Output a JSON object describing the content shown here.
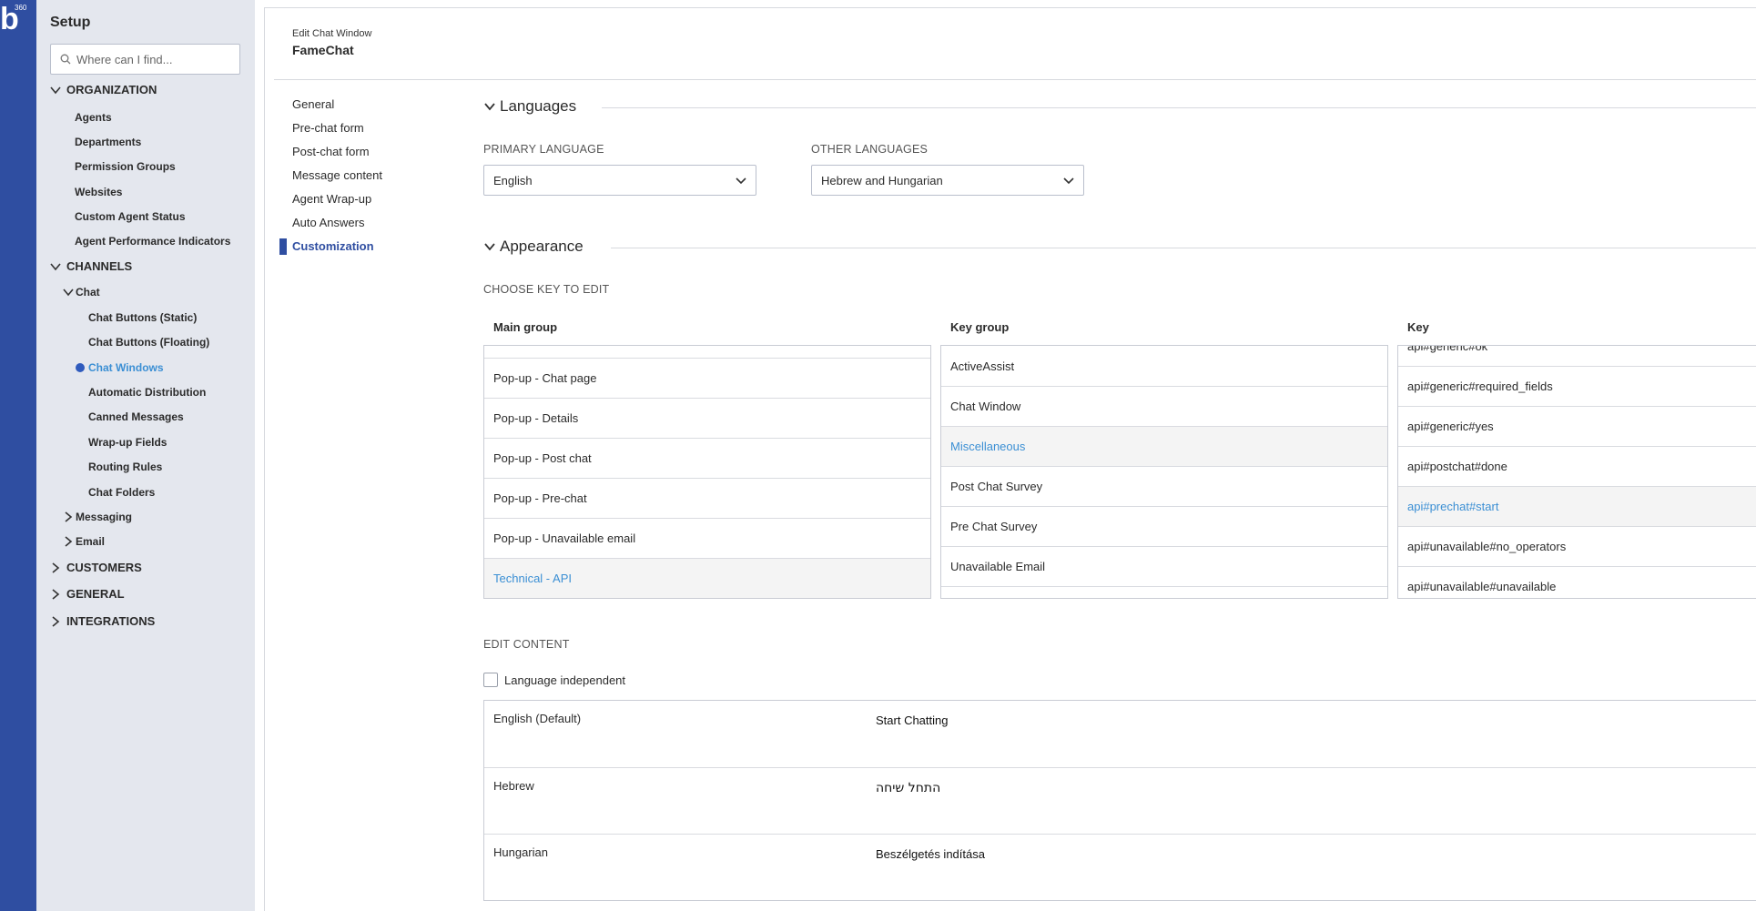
{
  "brand": {
    "letter": "b",
    "sup": "360"
  },
  "sidebar": {
    "title": "Setup",
    "search_placeholder": "Where can I find...",
    "sections": {
      "organization": "ORGANIZATION",
      "channels": "CHANNELS",
      "customers": "CUSTOMERS",
      "general": "GENERAL",
      "integrations": "INTEGRATIONS"
    },
    "org_items": [
      "Agents",
      "Departments",
      "Permission Groups",
      "Websites",
      "Custom Agent Status",
      "Agent Performance Indicators"
    ],
    "chat_label": "Chat",
    "chat_items": [
      "Chat Buttons (Static)",
      "Chat Buttons (Floating)",
      "Chat Windows",
      "Automatic Distribution",
      "Canned Messages",
      "Wrap-up Fields",
      "Routing Rules",
      "Chat Folders"
    ],
    "messaging_label": "Messaging",
    "email_label": "Email"
  },
  "header": {
    "subtitle": "Edit Chat Window",
    "title": "FameChat"
  },
  "subnav": [
    "General",
    "Pre-chat form",
    "Post-chat form",
    "Message content",
    "Agent Wrap-up",
    "Auto Answers",
    "Customization"
  ],
  "languages": {
    "title": "Languages",
    "primary_label": "PRIMARY LANGUAGE",
    "primary_value": "English",
    "other_label": "OTHER LANGUAGES",
    "other_value": "Hebrew and Hungarian"
  },
  "appearance": {
    "title": "Appearance",
    "choose_label": "CHOOSE KEY TO EDIT",
    "main_group": {
      "header": "Main group",
      "items": [
        "Pop-up - Chat page",
        "Pop-up - Details",
        "Pop-up - Post chat",
        "Pop-up - Pre-chat",
        "Pop-up - Unavailable email",
        "Technical - API"
      ]
    },
    "key_group": {
      "header": "Key group",
      "items": [
        "ActiveAssist",
        "Chat Window",
        "Miscellaneous",
        "Post Chat Survey",
        "Pre Chat Survey",
        "Unavailable Email"
      ]
    },
    "key": {
      "header": "Key",
      "items": [
        "api#generic#ok",
        "api#generic#required_fields",
        "api#generic#yes",
        "api#postchat#done",
        "api#prechat#start",
        "api#unavailable#no_operators",
        "api#unavailable#unavailable"
      ]
    }
  },
  "edit": {
    "label": "EDIT CONTENT",
    "language_independent": "Language independent",
    "rows": [
      {
        "lang": "English (Default)",
        "value": "Start Chatting"
      },
      {
        "lang": "Hebrew",
        "value": "התחל שיחה"
      },
      {
        "lang": "Hungarian",
        "value": "Beszélgetés indítása"
      }
    ]
  }
}
